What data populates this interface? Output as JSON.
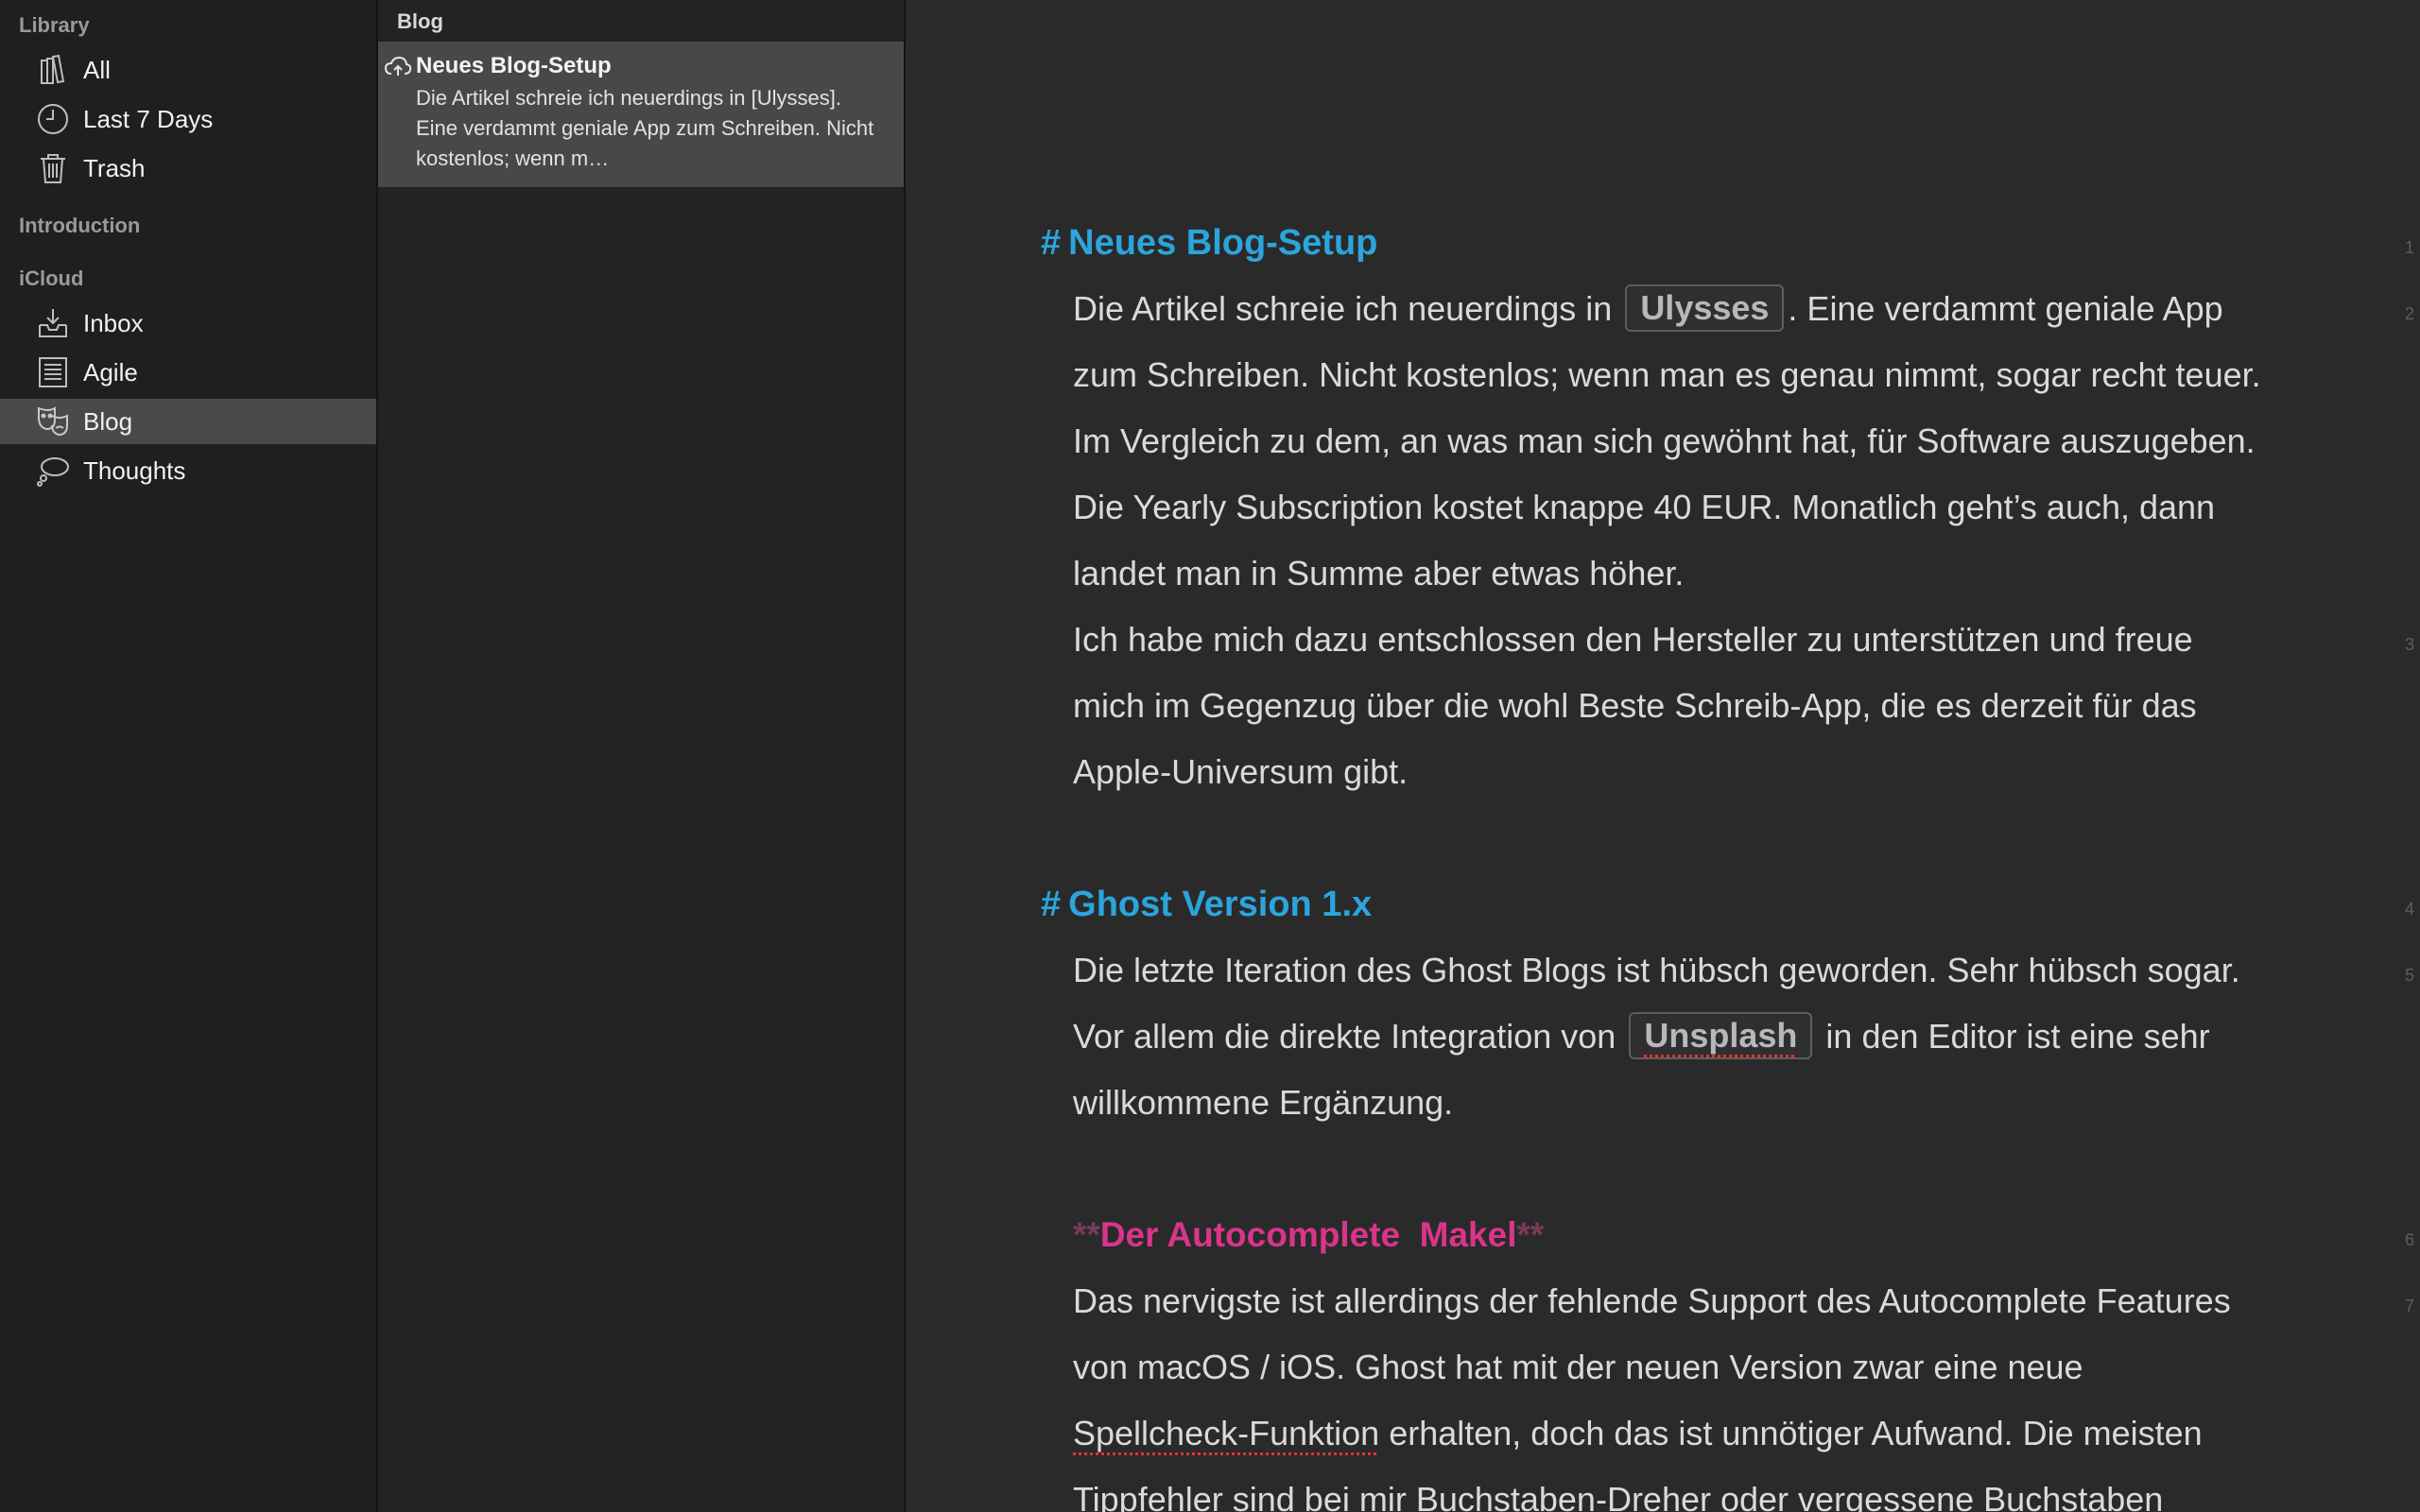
{
  "sidebar": {
    "library_header": "Library",
    "library_items": [
      {
        "label": "All",
        "icon": "books-icon"
      },
      {
        "label": "Last 7 Days",
        "icon": "clock-icon"
      },
      {
        "label": "Trash",
        "icon": "trash-icon"
      }
    ],
    "introduction_header": "Introduction",
    "icloud_header": "iCloud",
    "icloud_items": [
      {
        "label": "Inbox",
        "icon": "inbox-icon"
      },
      {
        "label": "Agile",
        "icon": "document-icon"
      },
      {
        "label": "Blog",
        "icon": "masks-icon",
        "selected": true
      },
      {
        "label": "Thoughts",
        "icon": "thought-bubble-icon"
      }
    ]
  },
  "sheets": {
    "title": "Blog",
    "items": [
      {
        "title": "Neues Blog-Setup",
        "preview": "Die Artikel schreie ich neuerdings in [Ulysses]. Eine verdammt geniale App zum Schreiben. Nicht kostenlos; wenn m…"
      }
    ]
  },
  "editor": {
    "h1_mark": "#",
    "h1": "Neues Blog-Setup",
    "p1_before": "Die Artikel schreie ich neuerdings in",
    "tag1": "Ulysses",
    "p1_after": ". Eine verdammt geniale App zum Schreiben. Nicht kostenlos; wenn man es genau nimmt, sogar recht teuer. Im Vergleich zu dem, an was man sich gewöhnt hat, für Software auszugeben. Die Yearly Subscription kostet knappe 40 EUR. Monatlich geht’s auch, dann landet man in Summe aber etwas höher.",
    "p2": "Ich habe mich dazu entschlossen den Hersteller zu unterstützen und freue mich im Gegenzug über die wohl Beste Schreib-App, die es derzeit für das Apple-Universum gibt.",
    "h2_mark": "#",
    "h2": "Ghost Version 1.x",
    "p3_before": "Die letzte Iteration des Ghost Blogs ist hübsch geworden. Sehr hübsch sogar. Vor allem die direkte Integration von",
    "tag2": "Unsplash",
    "p3_after": "in den Editor ist eine sehr willkommene Ergänzung.",
    "sub_ast_open": "**",
    "sub_text": "Der Autocomplete  Makel",
    "sub_ast_close": "**",
    "p4_before": "Das nervigste ist allerdings der fehlende Support des Autocomplete Features von macOS / iOS. Ghost hat mit der neuen Version zwar eine neue",
    "p4_spell": "Spellcheck-Funktion",
    "p4_after": "erhalten, doch das ist unnötiger Aufwand. Die meisten Tippfehler sind bei mir Buchstaben-Dreher oder vergessene Buchstaben",
    "line_numbers": [
      "1",
      "2",
      "3",
      "4",
      "5",
      "6",
      "7"
    ]
  },
  "colors": {
    "heading": "#2ba5dc",
    "bold_markup": "#d9358a",
    "spellcheck_underline": "#e0342f",
    "selection": "#4a4a4c"
  }
}
